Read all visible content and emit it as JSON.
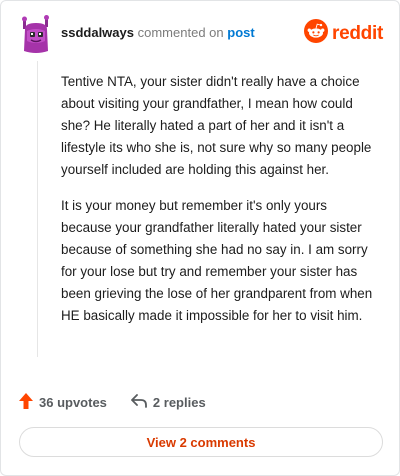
{
  "header": {
    "username": "ssddalways",
    "action_text": "commented on",
    "post_link": "post"
  },
  "brand": {
    "wordmark": "reddit",
    "icon": "reddit-logo-icon",
    "color": "#ff4500"
  },
  "comment": {
    "paragraphs": [
      "Tentive NTA, your sister didn't really have a choice about visiting your grandfather, I mean how could she? He literally hated a part of her and it isn't a lifestyle its who she is, not sure why so many people yourself included are holding this against her.",
      "It is your money but remember it's only yours because your grandfather literally hated your sister because of something she had no say in. I am sorry for your lose but try and remember your sister has been grieving the lose of her grandparent from when HE basically made it impossible for her to visit him."
    ]
  },
  "actions": {
    "upvotes_label": "36 upvotes",
    "upvote_icon": "upvote-arrow-icon",
    "upvote_color": "#ff4500",
    "replies_label": "2 replies",
    "reply_icon": "reply-arrow-icon"
  },
  "footer": {
    "view_comments_label": "View 2 comments",
    "accent_color": "#d93a00"
  }
}
